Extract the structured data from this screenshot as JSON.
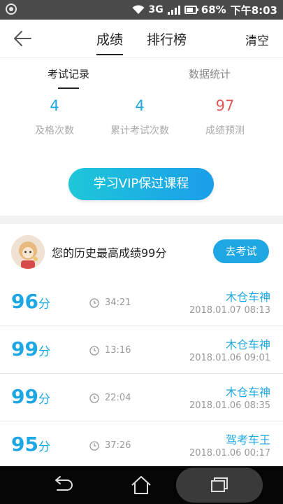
{
  "status_bar": {
    "network": "3G",
    "battery": "68%",
    "time": "下午8:03"
  },
  "header": {
    "tabs": [
      {
        "label": "成绩",
        "active": true
      },
      {
        "label": "排行榜",
        "active": false
      }
    ],
    "clear_label": "清空",
    "back_icon": "arrow-left-icon"
  },
  "subtabs": [
    {
      "label": "考试记录",
      "active": true
    },
    {
      "label": "数据统计",
      "active": false
    }
  ],
  "stats": [
    {
      "value": "4",
      "label": "及格次数",
      "color": "#1ea7e2"
    },
    {
      "value": "4",
      "label": "累计考试次数",
      "color": "#1ea7e2"
    },
    {
      "value": "97",
      "label": "成绩预测",
      "color": "#e05a5a"
    }
  ],
  "vip_button": "学习VIP保过课程",
  "best": {
    "text": "您的历史最高成绩99分",
    "button": "去考试"
  },
  "records": [
    {
      "score": "96",
      "unit": "分",
      "duration": "34:21",
      "name": "木仓车神",
      "time": "2018.01.07  08:13"
    },
    {
      "score": "99",
      "unit": "分",
      "duration": "13:16",
      "name": "木仓车神",
      "time": "2018.01.06  09:01"
    },
    {
      "score": "99",
      "unit": "分",
      "duration": "22:04",
      "name": "木仓车神",
      "time": "2018.01.06  08:35"
    },
    {
      "score": "95",
      "unit": "分",
      "duration": "37:26",
      "name": "驾考车王",
      "time": "2018.01.06  00:17"
    }
  ],
  "colors": {
    "accent": "#1ea7e2",
    "prediction": "#e05a5a"
  }
}
